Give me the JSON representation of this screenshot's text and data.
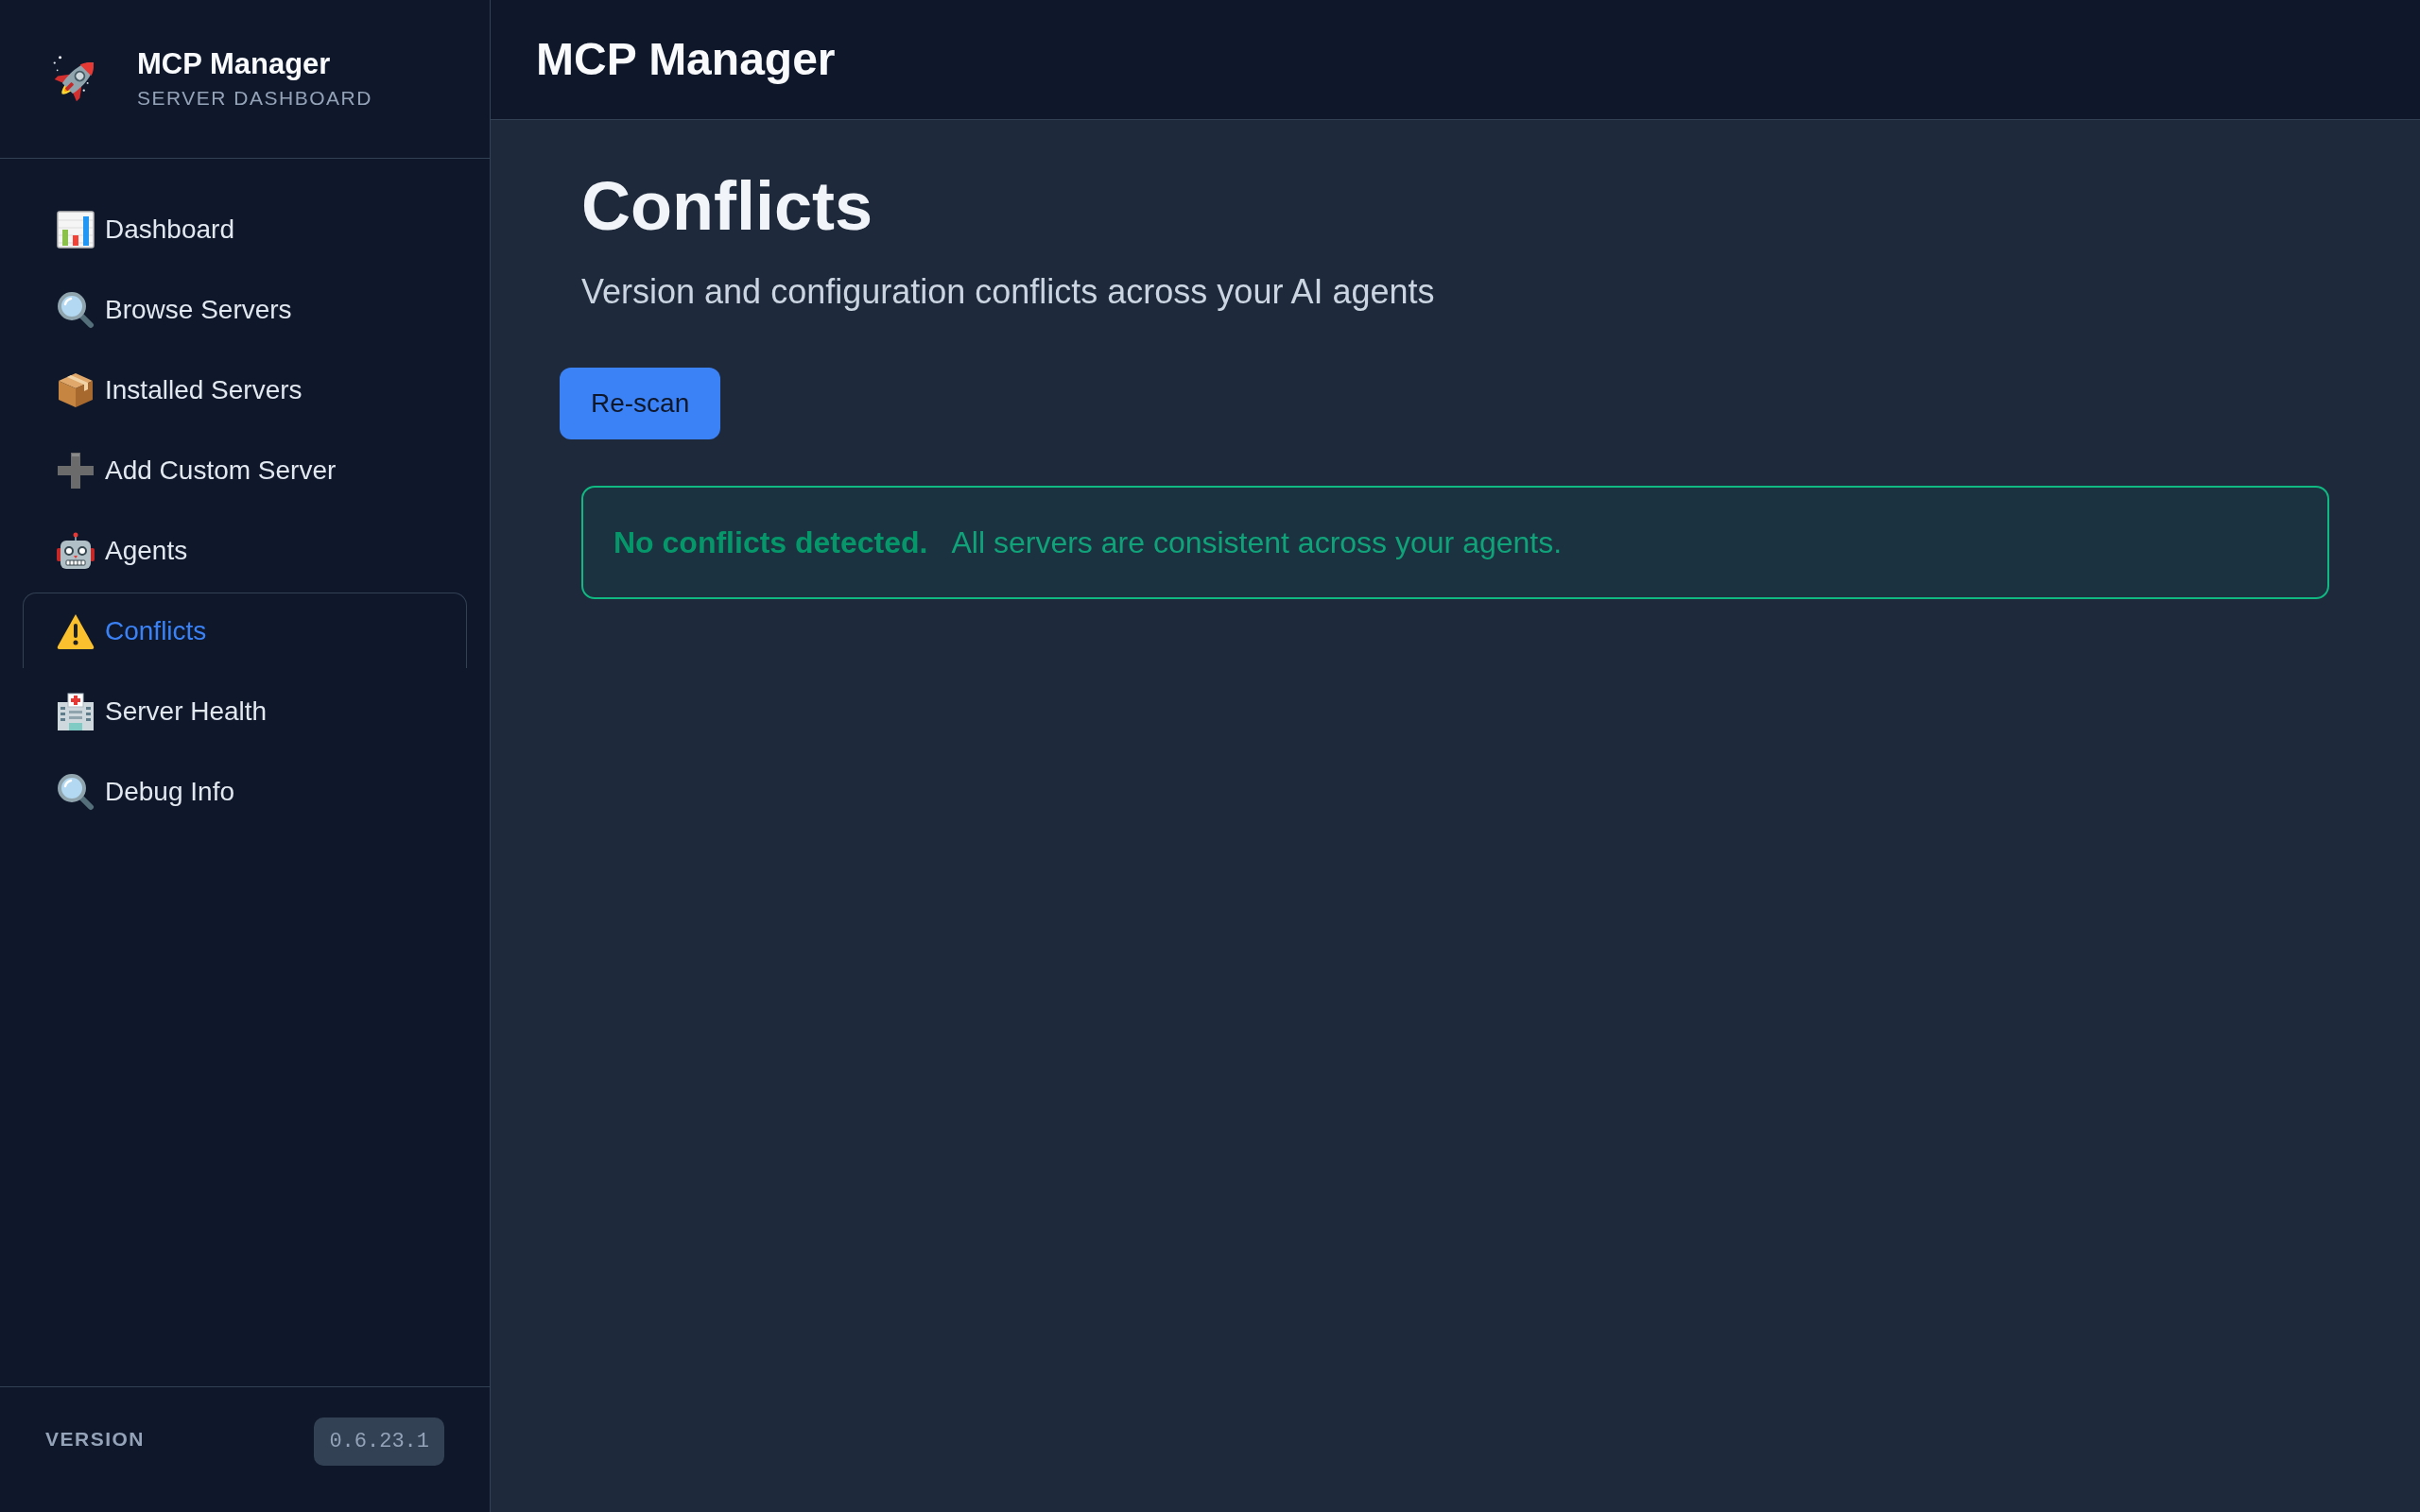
{
  "sidebar": {
    "brand": {
      "title": "MCP Manager",
      "subtitle": "SERVER DASHBOARD"
    },
    "nav_items": [
      {
        "label": "Dashboard",
        "selected": false
      },
      {
        "label": "Browse Servers",
        "selected": false
      },
      {
        "label": "Installed Servers",
        "selected": false
      },
      {
        "label": "Add Custom Server",
        "selected": false
      },
      {
        "label": "Agents",
        "selected": false
      },
      {
        "label": "Conflicts",
        "selected": true
      },
      {
        "label": "Server Health",
        "selected": false
      },
      {
        "label": "Debug Info",
        "selected": false
      }
    ],
    "footer": {
      "label": "VERSION",
      "version": "0.6.23.1"
    }
  },
  "header": {
    "title": "MCP Manager"
  },
  "page": {
    "title": "Conflicts",
    "subtitle": "Version and configuration conflicts across your AI agents",
    "rescan_button": "Re-scan",
    "alert": {
      "kind": "success",
      "title": "No conflicts detected.",
      "message": "All servers are consistent across your agents."
    }
  }
}
